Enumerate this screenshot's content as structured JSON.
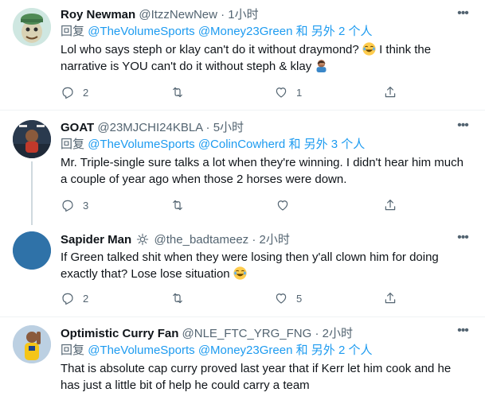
{
  "tweets": [
    {
      "name": "Roy Newman",
      "handle": "@ItzzNewNew",
      "dot": "·",
      "time": "1小时",
      "reply_prefix": "回复",
      "reply_mentions": "@TheVolumeSports @Money23Green",
      "reply_suffix": "和 另外 2 个人",
      "text_1": "Lol who says steph or klay can't do it without draymond?",
      "text_2": "I think the narrative is YOU can't do it without steph & klay",
      "emoji_1": "face-with-tears-of-joy",
      "emoji_2": "person-facepalming",
      "counts": {
        "reply": "2",
        "retweet": "",
        "like": "1"
      }
    },
    {
      "name": "GOAT",
      "handle": "@23MJCHI24KBLA",
      "dot": "·",
      "time": "5小时",
      "reply_prefix": "回复",
      "reply_mentions": "@TheVolumeSports @ColinCowherd",
      "reply_suffix": "和 另外 3 个人",
      "text": "Mr. Triple-single sure talks a lot when they're winning. I didn't hear him much a couple of year ago when those 2 horses were down.",
      "counts": {
        "reply": "3",
        "retweet": "",
        "like": ""
      }
    },
    {
      "name": "Sapider Man",
      "badge": "gear-badge-icon",
      "handle": "@the_badtameez",
      "dot": "·",
      "time": "2小时",
      "text": "If Green talked shit when they were losing then y'all clown him for doing exactly that? Lose lose situation",
      "emoji": "face-with-tears-of-joy",
      "counts": {
        "reply": "2",
        "retweet": "",
        "like": "5"
      }
    },
    {
      "name": "Optimistic Curry Fan",
      "handle": "@NLE_FTC_YRG_FNG",
      "dot": "·",
      "time": "2小时",
      "reply_prefix": "回复",
      "reply_mentions": "@TheVolumeSports @Money23Green",
      "reply_suffix": "和 另外 2 个人",
      "text": "That is absolute cap curry proved last year that if Kerr let him cook and he has just a little bit of help he could carry a team"
    }
  ],
  "colors": {
    "link": "#1d9bf0",
    "secondary": "#536471",
    "primary": "#0f1419",
    "divider": "#eff3f4",
    "thread_line": "#cfd9de"
  }
}
